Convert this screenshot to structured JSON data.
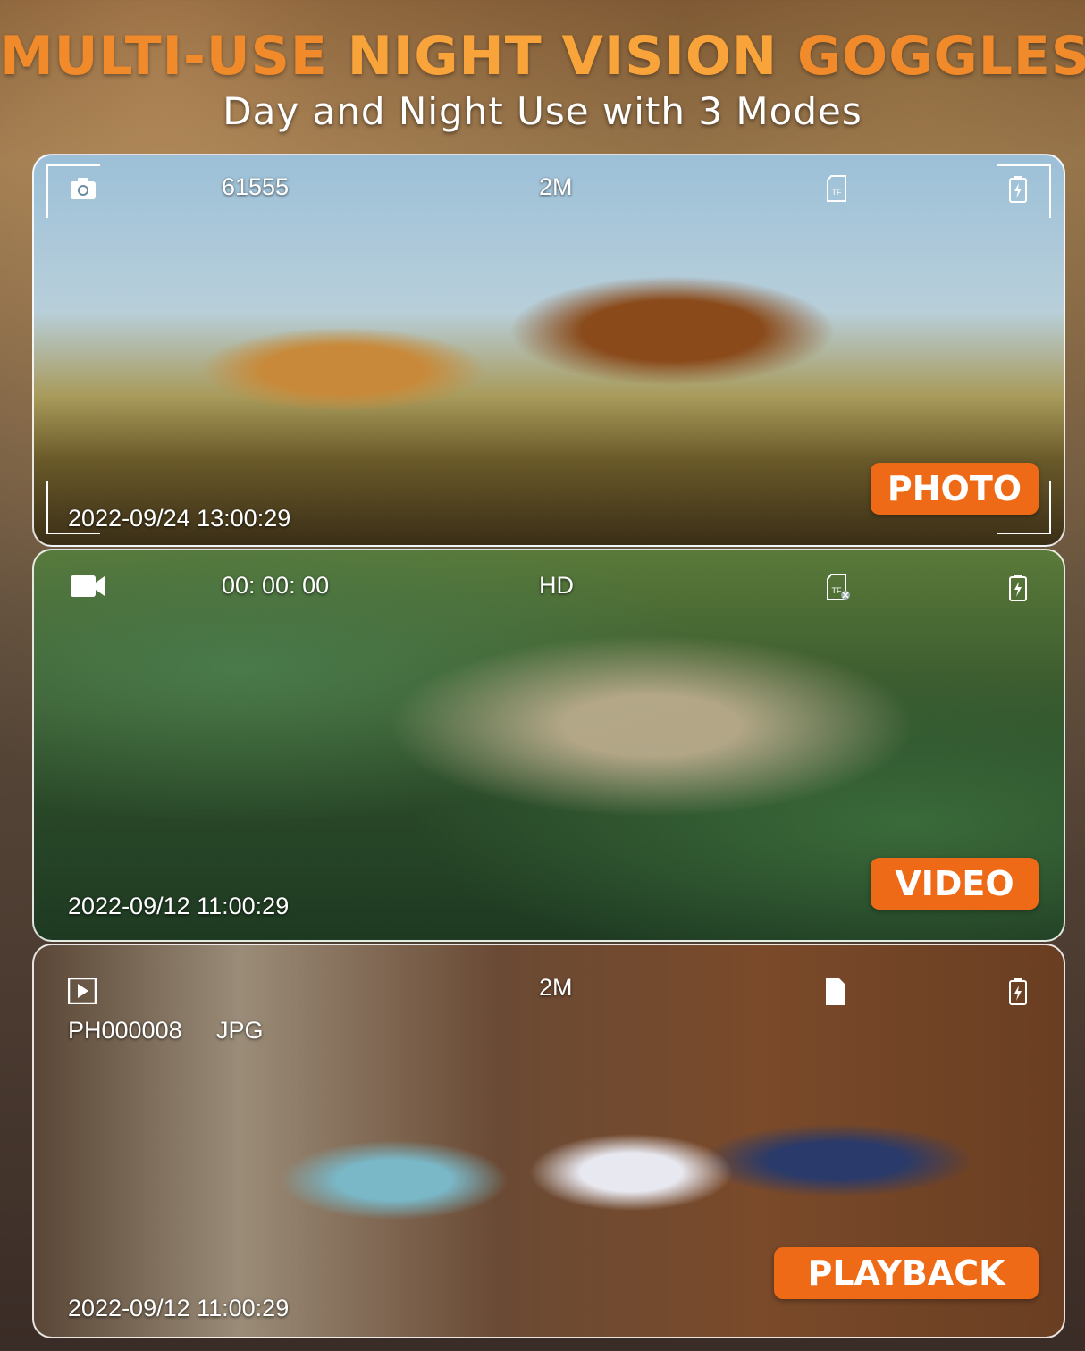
{
  "header": {
    "title_part1": "MULTI-USE ",
    "title_part2": "NIGHT VISION ",
    "title_part3": "GOGGLES",
    "subtitle": "Day and Night Use with 3 Modes"
  },
  "panels": {
    "photo": {
      "mode_icon": "camera-icon",
      "counter": "61555",
      "resolution": "2M",
      "storage_icon": "sd-card-icon",
      "battery_icon": "battery-charging-icon",
      "mode_label": "PHOTO",
      "timestamp": "2022-09/24 13:00:29"
    },
    "video": {
      "mode_icon": "video-camera-icon",
      "elapsed": "00: 00: 00",
      "resolution": "HD",
      "storage_icon": "sd-card-missing-icon",
      "battery_icon": "battery-charging-icon",
      "mode_label": "VIDEO",
      "timestamp": "2022-09/12 11:00:29"
    },
    "playback": {
      "mode_icon": "play-icon",
      "filename": "PH000008",
      "filetype": "JPG",
      "resolution": "2M",
      "storage_icon": "file-icon",
      "battery_icon": "battery-charging-icon",
      "mode_label": "PLAYBACK",
      "timestamp": "2022-09/12 11:00:29"
    }
  },
  "colors": {
    "accent": "#ee6a16",
    "title": "#f08a2a"
  }
}
